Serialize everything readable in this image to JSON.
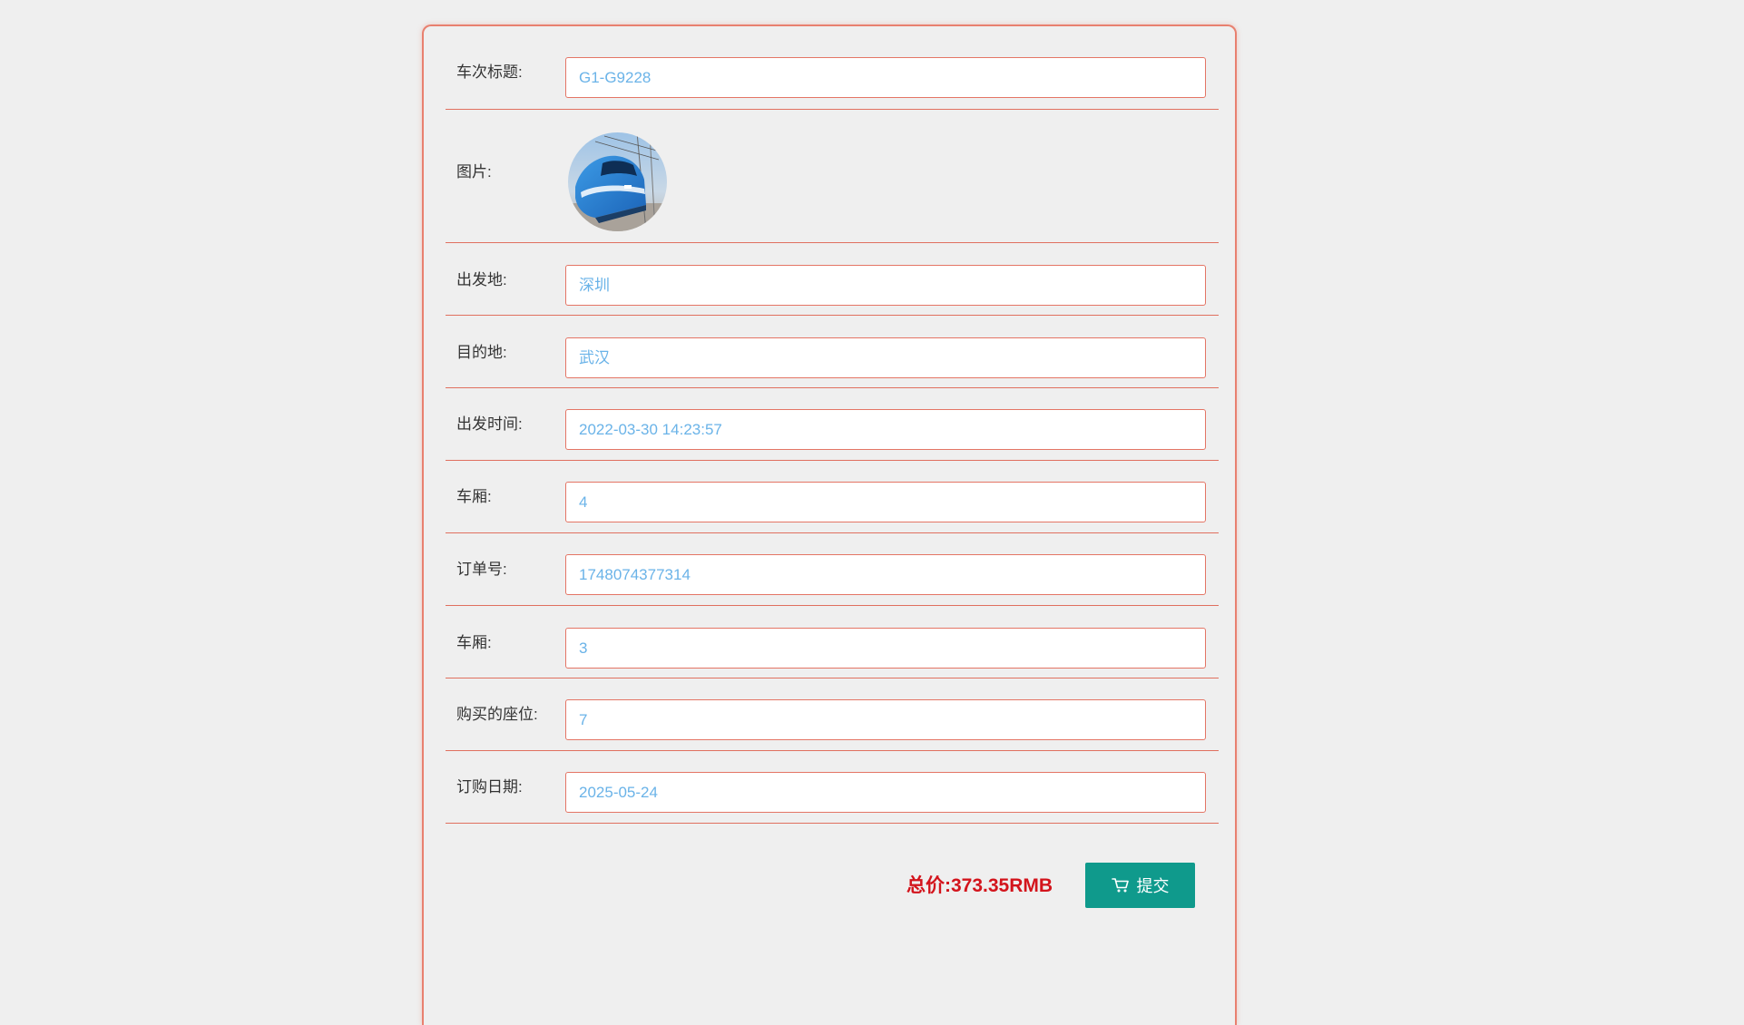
{
  "form": {
    "rows": [
      {
        "label": "车次标题:",
        "value": "G1-G9228"
      },
      {
        "label": "图片:"
      },
      {
        "label": "出发地:",
        "value": "深圳"
      },
      {
        "label": "目的地:",
        "value": "武汉"
      },
      {
        "label": "出发时间:",
        "value": "2022-03-30 14:23:57"
      },
      {
        "label": "车厢:",
        "value": "4"
      },
      {
        "label": "订单号:",
        "value": "1748074377314"
      },
      {
        "label": "车厢:",
        "value": "3"
      },
      {
        "label": "购买的座位:",
        "value": "7"
      },
      {
        "label": "订购日期:",
        "value": "2025-05-24"
      }
    ]
  },
  "footer": {
    "total": "总价:373.35RMB",
    "submit_label": "提交",
    "submit_icon": "cart-icon"
  },
  "colors": {
    "accent_border": "#e8806f",
    "field_text": "#6ab3e8",
    "total_text": "#d3141c",
    "submit_bg": "#0f9a8c"
  }
}
